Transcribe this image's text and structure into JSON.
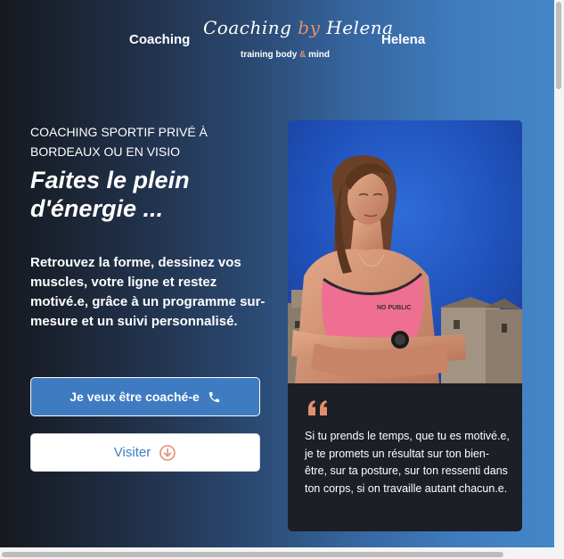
{
  "header": {
    "nav_left": "Coaching",
    "nav_right": "Helena",
    "logo": {
      "script_part1": "Coaching ",
      "script_by": "by",
      "script_part2": " Helena",
      "tag_part1": "training body ",
      "tag_amp": "&",
      "tag_part2": " mind"
    }
  },
  "hero": {
    "eyebrow": "COACHING SPORTIF PRIVÉ À BORDEAUX OU EN VISIO",
    "headline": "Faites le plein d'énergie ...",
    "lead": "Retrouvez la forme, dessinez vos muscles, votre ligne et restez motivé.e, grâce à un programme sur-mesure et un suivi personnalisé.",
    "primary_button": "Je veux être coaché-e",
    "secondary_button": "Visiter"
  },
  "card": {
    "quote": "Si tu prends le temps, que tu es motivé.e, je te promets un résultat sur ton bien-être, sur ta posture, sur ton ressenti dans ton corps, si on travaille autant chacun.e.",
    "shirt_text": "NO PUBLIC"
  },
  "icons": {
    "primary_button_icon": "phone-icon",
    "secondary_button_icon": "arrow-down-circle-icon",
    "quote_icon": "quote-icon"
  },
  "colors": {
    "accent_blue": "#3e7bc1",
    "accent_orange": "#e1906f",
    "card_bg": "#1c1f25"
  }
}
